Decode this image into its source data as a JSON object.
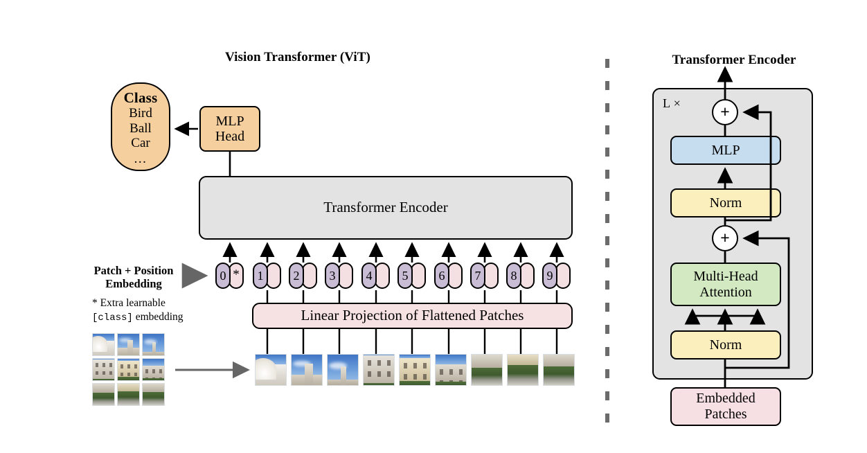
{
  "left_panel": {
    "title": "Vision Transformer (ViT)",
    "class_box": {
      "header": "Class",
      "items": [
        "Bird",
        "Ball",
        "Car"
      ],
      "ellipsis": "...",
      "color": "#f6cf9f"
    },
    "mlp_head": {
      "line1": "MLP",
      "line2": "Head",
      "color": "#f6cf9f"
    },
    "encoder_bar": {
      "label": "Transformer Encoder",
      "color": "#e3e3e3"
    },
    "linear_projection": {
      "label": "Linear Projection of Flattened Patches",
      "color": "#f7e2e3"
    },
    "embedding_label": {
      "line1": "Patch + Position",
      "line2": "Embedding"
    },
    "footnote": {
      "line1": "* Extra learnable",
      "mono": "[class]",
      "line2_tail": " embedding"
    },
    "tokens": [
      {
        "num": "0",
        "pos": "*"
      },
      {
        "num": "1",
        "pos": ""
      },
      {
        "num": "2",
        "pos": ""
      },
      {
        "num": "3",
        "pos": ""
      },
      {
        "num": "4",
        "pos": ""
      },
      {
        "num": "5",
        "pos": ""
      },
      {
        "num": "6",
        "pos": ""
      },
      {
        "num": "7",
        "pos": ""
      },
      {
        "num": "8",
        "pos": ""
      },
      {
        "num": "9",
        "pos": ""
      }
    ],
    "token_colors": {
      "number_pill": "#c9bcd5",
      "position_pill": "#f4e0e2"
    },
    "source_image_grid": {
      "rows": 3,
      "cols": 3,
      "description": "photograph of a basilica split into 3x3 patches"
    },
    "flattened_patch_count": 9
  },
  "right_panel": {
    "title": "Transformer Encoder",
    "repeat_label": "L ×",
    "blocks": [
      {
        "id": "mlp",
        "label": "MLP",
        "color": "#c6ddf0"
      },
      {
        "id": "norm_top",
        "label": "Norm",
        "color": "#fbefbd"
      },
      {
        "id": "attention",
        "line1": "Multi-Head",
        "line2": "Attention",
        "color": "#d2e9c2"
      },
      {
        "id": "norm_bottom",
        "label": "Norm",
        "color": "#fbefbd"
      },
      {
        "id": "embedded_patches",
        "line1": "Embedded",
        "line2": "Patches",
        "color": "#f7e0e3"
      }
    ],
    "residual_nodes": [
      {
        "id": "add_top",
        "symbol": "+"
      },
      {
        "id": "add_bottom",
        "symbol": "+"
      }
    ],
    "outer_box_color": "#e3e3e3"
  },
  "divider": {
    "style": "dashed",
    "color": "#6b6b6b"
  }
}
